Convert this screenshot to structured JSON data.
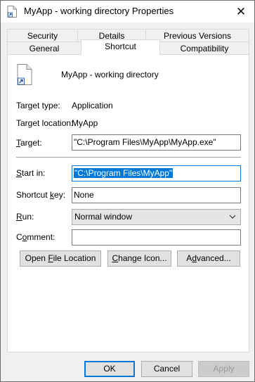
{
  "window": {
    "title": "MyApp - working directory Properties",
    "close_glyph": "✕"
  },
  "tabs": {
    "row1": [
      "Security",
      "Details",
      "Previous Versions"
    ],
    "row2": [
      "General",
      "Shortcut",
      "Compatibility"
    ],
    "active": "Shortcut"
  },
  "shortcut": {
    "name": "MyApp - working directory",
    "target_type_label": "Target type:",
    "target_type_value": "Application",
    "target_location_label": "Target location:",
    "target_location_value": "MyApp",
    "target_label_pre": "",
    "target_label_ul": "T",
    "target_label_post": "arget:",
    "target_value": "\"C:\\Program Files\\MyApp\\MyApp.exe\"",
    "start_in_label_pre": "",
    "start_in_label_ul": "S",
    "start_in_label_post": "tart in:",
    "start_in_value": "\"C:\\Program Files\\MyApp\"",
    "shortcut_key_label_pre": "Shortcut ",
    "shortcut_key_label_ul": "k",
    "shortcut_key_label_post": "ey:",
    "shortcut_key_value": "None",
    "run_label_pre": "",
    "run_label_ul": "R",
    "run_label_post": "un:",
    "run_value": "Normal window",
    "comment_label_pre": "C",
    "comment_label_ul": "o",
    "comment_label_post": "mment:",
    "comment_value": ""
  },
  "actions": {
    "open_file_location_pre": "Open ",
    "open_file_location_ul": "F",
    "open_file_location_post": "ile Location",
    "change_icon_pre": "",
    "change_icon_ul": "C",
    "change_icon_post": "hange Icon...",
    "advanced_pre": "A",
    "advanced_ul": "d",
    "advanced_post": "vanced..."
  },
  "footer": {
    "ok": "OK",
    "cancel": "Cancel",
    "apply": "Apply"
  },
  "icons": {
    "title": "shortcut-file-icon",
    "shortcut": "shortcut-file-icon",
    "run_dropdown": "chevron-down-icon",
    "close": "close-icon"
  },
  "colors": {
    "accent": "#0078d7",
    "dialog_bg": "#f0f0f0",
    "panel_bg": "#ffffff"
  }
}
